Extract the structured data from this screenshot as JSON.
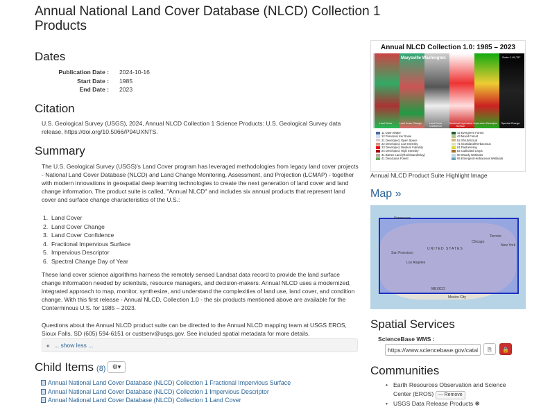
{
  "page_title": "Annual National Land Cover Database (NLCD) Collection 1 Products",
  "dates": {
    "heading": "Dates",
    "rows": [
      {
        "label": "Publication Date :",
        "value": "2024-10-16"
      },
      {
        "label": "Start Date :",
        "value": "1985"
      },
      {
        "label": "End Date :",
        "value": "2023"
      }
    ]
  },
  "citation": {
    "heading": "Citation",
    "text": "U.S. Geological Survey (USGS), 2024, Annual NLCD Collection 1 Science Products: U.S. Geological Survey data release, https://doi.org/10.5066/P94UXNTS."
  },
  "summary": {
    "heading": "Summary",
    "p1": "The U.S. Geological Survey (USGS)'s Land Cover program has leveraged methodologies from legacy land cover projects - National Land Cover Database (NLCD) and Land Change Monitoring, Assessment, and Projection (LCMAP) - together with modern innovations in geospatial deep learning technologies to create the next generation of land cover and land change information. The product suite is called, \"Annual NLCD\" and includes six annual products that represent land cover and surface change characteristics of the U.S.:",
    "list": [
      "Land Cover",
      "Land Cover Change",
      "Land Cover Confidence",
      "Fractional Impervious Surface",
      "Impervious Descriptor",
      "Spectral Change Day of Year"
    ],
    "p2": "These land cover science algorithms harness the remotely sensed Landsat data record to provide the land surface change information needed by scientists, resource managers, and decision-makers. Annual NLCD uses a modernized, integrated approach to map, monitor, synthesize, and understand the complexities of land use, land cover, and condition change. With this first release - Annual NLCD, Collection 1.0 - the six products mentioned above are available for the Conterminous U.S. for 1985 – 2023.",
    "p3": "Questions about the Annual NLCD product suite can be directed to the Annual NLCD mapping team at USGS EROS, Sioux Falls, SD (605) 594-6151 or custserv@usgs.gov. See included spatial metadata for more details.",
    "show_less": "... show less ..."
  },
  "child_items": {
    "heading": "Child Items",
    "count": "(8)",
    "gear_caret": "▾",
    "items": [
      "Annual National Land Cover Database (NLCD) Collection 1 Fractional Impervious Surface",
      "Annual National Land Cover Database (NLCD) Collection 1 Impervious Descriptor",
      "Annual National Land Cover Database (NLCD) Collection 1 Land Cover"
    ]
  },
  "highlight_image": {
    "title": "Annual NLCD Collection 1.0: 1985 – 2023",
    "map_label": "Marysville Washington",
    "scale_label": "Scale: 1:81,757",
    "panel_labels": [
      "Land Cover",
      "Land Cover Change",
      "Land Cover Confidence",
      "Fractional Impervious Surface",
      "Impervious Descriptor",
      "Spectral Change"
    ],
    "legend_left": [
      {
        "label": "11 Open Water",
        "color": "#466b9f"
      },
      {
        "label": "12 Perennial Ice/ Snow",
        "color": "#d1def8"
      },
      {
        "label": "21 Developed, Open Space",
        "color": "#dec5c5"
      },
      {
        "label": "22 Developed, Low Intensity",
        "color": "#d99282"
      },
      {
        "label": "23 Developed, Medium Intensity",
        "color": "#eb0000"
      },
      {
        "label": "24 Developed, High Intensity",
        "color": "#ab0000"
      },
      {
        "label": "31 Barren Land (Rock/Sand/Clay)",
        "color": "#b3ac9f"
      },
      {
        "label": "41 Deciduous Forest",
        "color": "#68ab5f"
      }
    ],
    "legend_right": [
      {
        "label": "42 Evergreen Forest",
        "color": "#1c5f2c"
      },
      {
        "label": "43 Mixed Forest",
        "color": "#b5c58f"
      },
      {
        "label": "52 Shrub/Scrub",
        "color": "#ccb879"
      },
      {
        "label": "71 Grassland/Herbaceous",
        "color": "#dfdfc2"
      },
      {
        "label": "81 Pasture/Hay",
        "color": "#dcd939"
      },
      {
        "label": "82 Cultivated Crops",
        "color": "#ab6c28"
      },
      {
        "label": "90 Woody Wetlands",
        "color": "#b8d9eb"
      },
      {
        "label": "95 Emergent Herbaceous Wetlands",
        "color": "#6c9fb8"
      }
    ],
    "caption": "Annual NLCD Product Suite Highlight Image"
  },
  "map": {
    "heading": "Map »",
    "labels": [
      "Vancouver",
      "Chicago",
      "Toronto",
      "New York",
      "UNITED STATES",
      "San Francisco",
      "Los Angeles",
      "MEXICO",
      "Mexico City"
    ]
  },
  "spatial_services": {
    "heading": "Spatial Services",
    "wms_label": "ScienceBase WMS :",
    "wms_value": "https://www.sciencebase.gov/catal"
  },
  "communities": {
    "heading": "Communities",
    "items": [
      {
        "label": "Earth Resources Observation and Science Center (EROS)",
        "action": "Remove"
      },
      {
        "label": "USGS Data Release Products ❋",
        "action": ""
      }
    ]
  }
}
